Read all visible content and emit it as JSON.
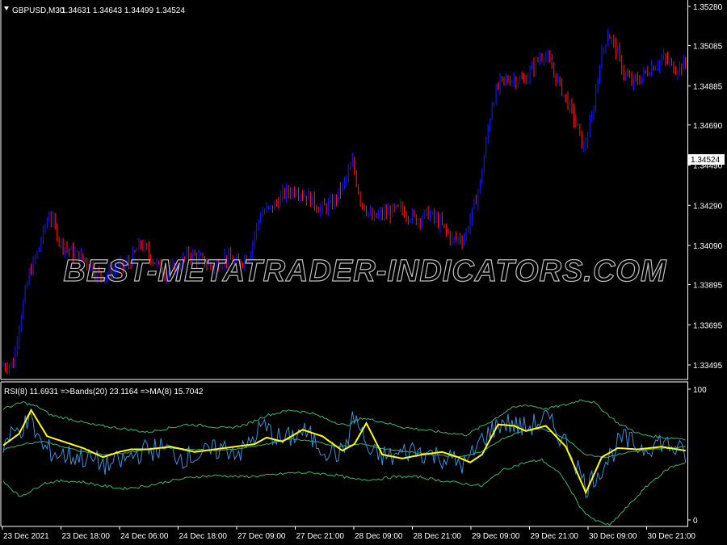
{
  "price_info": {
    "symbol": "GBPUSD,M30",
    "ohlc": "1.34631 1.34643 1.34499 1.34524"
  },
  "indicator_info": "RSI(8) 11.6931  =>Bands(20) 23.1164  =>MA(8) 15.7042",
  "current_price_tag": "1.34524",
  "watermark": "BEST-METATRADER-INDICATORS.COM",
  "price_axis_labels": [
    "1.35280",
    "1.35085",
    "1.34885",
    "1.34690",
    "1.34490",
    "1.34290",
    "1.34090",
    "1.33895",
    "1.33695",
    "1.33495"
  ],
  "indicator_axis_labels": [
    "100",
    "0"
  ],
  "time_labels": [
    "23 Dec 2021",
    "23 Dec 18:00",
    "24 Dec 06:00",
    "24 Dec 18:00",
    "27 Dec 09:00",
    "27 Dec 21:00",
    "28 Dec 09:00",
    "28 Dec 21:00",
    "29 Dec 09:00",
    "29 Dec 21:00",
    "30 Dec 09:00",
    "30 Dec 21:00"
  ],
  "colors": {
    "background": "#000000",
    "bull": "#1515ff",
    "bear": "#ff1010",
    "rsi": "#3a8fd8",
    "ma": "#ffff00",
    "bands": "#3cb371",
    "frame": "#ffffff"
  },
  "chart_data": [
    {
      "type": "line",
      "title": "GBPUSD,M30",
      "ylim": [
        1.334,
        1.3532
      ],
      "x": [
        "23 Dec 2021",
        "23 Dec 18:00",
        "24 Dec 06:00",
        "24 Dec 18:00",
        "27 Dec 09:00",
        "27 Dec 21:00",
        "28 Dec 09:00",
        "28 Dec 21:00",
        "29 Dec 09:00",
        "29 Dec 21:00",
        "30 Dec 09:00",
        "30 Dec 21:00"
      ],
      "series": [
        {
          "name": "GBPUSD,M30",
          "anchors": [
            [
              0,
              1.3349
            ],
            [
              6,
              1.335
            ],
            [
              9,
              1.337
            ],
            [
              14,
              1.3395
            ],
            [
              18,
              1.3405
            ],
            [
              24,
              1.3425
            ],
            [
              30,
              1.341
            ],
            [
              36,
              1.3405
            ],
            [
              42,
              1.3402
            ],
            [
              48,
              1.3395
            ],
            [
              52,
              1.3394
            ],
            [
              58,
              1.3398
            ],
            [
              64,
              1.34
            ],
            [
              70,
              1.341
            ],
            [
              76,
              1.3402
            ],
            [
              82,
              1.3395
            ],
            [
              88,
              1.3398
            ],
            [
              94,
              1.3405
            ],
            [
              100,
              1.3402
            ],
            [
              106,
              1.3398
            ],
            [
              112,
              1.3403
            ],
            [
              118,
              1.34
            ],
            [
              124,
              1.3404
            ],
            [
              130,
              1.3425
            ],
            [
              136,
              1.3428
            ],
            [
              142,
              1.3435
            ],
            [
              148,
              1.3437
            ],
            [
              154,
              1.3433
            ],
            [
              160,
              1.3427
            ],
            [
              166,
              1.343
            ],
            [
              172,
              1.344
            ],
            [
              176,
              1.345
            ],
            [
              180,
              1.3432
            ],
            [
              186,
              1.3422
            ],
            [
              192,
              1.3425
            ],
            [
              200,
              1.3427
            ],
            [
              208,
              1.3422
            ],
            [
              214,
              1.3425
            ],
            [
              220,
              1.342
            ],
            [
              226,
              1.3412
            ],
            [
              232,
              1.3413
            ],
            [
              236,
              1.3425
            ],
            [
              240,
              1.344
            ],
            [
              246,
              1.348
            ],
            [
              250,
              1.349
            ],
            [
              256,
              1.3492
            ],
            [
              262,
              1.3491
            ],
            [
              268,
              1.35
            ],
            [
              272,
              1.3505
            ],
            [
              278,
              1.3493
            ],
            [
              284,
              1.348
            ],
            [
              288,
              1.347
            ],
            [
              292,
              1.3457
            ],
            [
              296,
              1.3472
            ],
            [
              300,
              1.35
            ],
            [
              304,
              1.3515
            ],
            [
              308,
              1.3507
            ],
            [
              312,
              1.3495
            ],
            [
              316,
              1.349
            ],
            [
              320,
              1.3492
            ],
            [
              326,
              1.3498
            ],
            [
              332,
              1.3502
            ],
            [
              338,
              1.3497
            ],
            [
              342,
              1.3499
            ]
          ]
        }
      ]
    },
    {
      "type": "line",
      "title": "RSI(8) 11.6931  =>Bands(20) 23.1164  =>MA(8) 15.7042",
      "ylim": [
        0,
        100
      ],
      "series": [
        {
          "name": "RSI(8)",
          "last": 11.6931,
          "anchors": [
            [
              0,
              58
            ],
            [
              8,
              70
            ],
            [
              14,
              75
            ],
            [
              20,
              55
            ],
            [
              28,
              50
            ],
            [
              40,
              48
            ],
            [
              52,
              42
            ],
            [
              60,
              45
            ],
            [
              70,
              53
            ],
            [
              80,
              55
            ],
            [
              90,
              48
            ],
            [
              100,
              50
            ],
            [
              110,
              55
            ],
            [
              120,
              52
            ],
            [
              130,
              72
            ],
            [
              140,
              60
            ],
            [
              150,
              68
            ],
            [
              160,
              55
            ],
            [
              170,
              50
            ],
            [
              176,
              80
            ],
            [
              184,
              50
            ],
            [
              195,
              48
            ],
            [
              205,
              54
            ],
            [
              215,
              50
            ],
            [
              225,
              46
            ],
            [
              232,
              42
            ],
            [
              240,
              62
            ],
            [
              250,
              75
            ],
            [
              262,
              70
            ],
            [
              272,
              78
            ],
            [
              284,
              55
            ],
            [
              292,
              25
            ],
            [
              300,
              40
            ],
            [
              310,
              62
            ],
            [
              320,
              55
            ],
            [
              330,
              60
            ],
            [
              342,
              50
            ]
          ]
        },
        {
          "name": "MA(8)",
          "last": 15.7042,
          "anchors": [
            [
              0,
              57
            ],
            [
              8,
              66
            ],
            [
              14,
              84
            ],
            [
              22,
              64
            ],
            [
              30,
              60
            ],
            [
              40,
              55
            ],
            [
              50,
              48
            ],
            [
              58,
              52
            ],
            [
              64,
              54
            ],
            [
              72,
              54
            ],
            [
              84,
              56
            ],
            [
              96,
              52
            ],
            [
              106,
              54
            ],
            [
              116,
              56
            ],
            [
              126,
              58
            ],
            [
              132,
              63
            ],
            [
              140,
              60
            ],
            [
              150,
              69
            ],
            [
              160,
              64
            ],
            [
              170,
              53
            ],
            [
              176,
              58
            ],
            [
              182,
              74
            ],
            [
              190,
              50
            ],
            [
              200,
              47
            ],
            [
              210,
              50
            ],
            [
              220,
              52
            ],
            [
              228,
              48
            ],
            [
              234,
              44
            ],
            [
              240,
              50
            ],
            [
              248,
              73
            ],
            [
              256,
              72
            ],
            [
              262,
              68
            ],
            [
              272,
              72
            ],
            [
              282,
              56
            ],
            [
              292,
              21
            ],
            [
              300,
              48
            ],
            [
              308,
              55
            ],
            [
              318,
              54
            ],
            [
              330,
              56
            ],
            [
              342,
              53
            ]
          ]
        },
        {
          "name": "Bands(20)",
          "last": 23.1164,
          "upper": [
            [
              0,
              85
            ],
            [
              10,
              90
            ],
            [
              18,
              86
            ],
            [
              24,
              80
            ],
            [
              34,
              77
            ],
            [
              44,
              73
            ],
            [
              54,
              71
            ],
            [
              64,
              69
            ],
            [
              72,
              67
            ],
            [
              82,
              70
            ],
            [
              92,
              73
            ],
            [
              102,
              72
            ],
            [
              112,
              70
            ],
            [
              122,
              73
            ],
            [
              132,
              80
            ],
            [
              144,
              84
            ],
            [
              154,
              82
            ],
            [
              164,
              76
            ],
            [
              172,
              72
            ],
            [
              180,
              78
            ],
            [
              190,
              75
            ],
            [
              200,
              71
            ],
            [
              210,
              69
            ],
            [
              220,
              67
            ],
            [
              232,
              65
            ],
            [
              244,
              75
            ],
            [
              254,
              85
            ],
            [
              262,
              88
            ],
            [
              272,
              85
            ],
            [
              282,
              88
            ],
            [
              290,
              92
            ],
            [
              296,
              90
            ],
            [
              308,
              74
            ],
            [
              320,
              65
            ],
            [
              332,
              63
            ],
            [
              342,
              62
            ]
          ],
          "middle": [
            [
              0,
              54
            ],
            [
              10,
              58
            ],
            [
              20,
              60
            ],
            [
              30,
              56
            ],
            [
              40,
              52
            ],
            [
              50,
              50
            ],
            [
              60,
              51
            ],
            [
              72,
              54
            ],
            [
              84,
              55
            ],
            [
              96,
              54
            ],
            [
              108,
              53
            ],
            [
              120,
              55
            ],
            [
              132,
              58
            ],
            [
              144,
              62
            ],
            [
              156,
              60
            ],
            [
              168,
              56
            ],
            [
              180,
              58
            ],
            [
              192,
              54
            ],
            [
              204,
              52
            ],
            [
              216,
              50
            ],
            [
              228,
              48
            ],
            [
              240,
              52
            ],
            [
              250,
              62
            ],
            [
              260,
              68
            ],
            [
              270,
              70
            ],
            [
              282,
              62
            ],
            [
              292,
              50
            ],
            [
              302,
              48
            ],
            [
              314,
              52
            ],
            [
              326,
              54
            ],
            [
              342,
              56
            ]
          ],
          "lower": [
            [
              0,
              30
            ],
            [
              8,
              18
            ],
            [
              14,
              22
            ],
            [
              20,
              28
            ],
            [
              30,
              30
            ],
            [
              40,
              29
            ],
            [
              50,
              26
            ],
            [
              60,
              24
            ],
            [
              72,
              26
            ],
            [
              84,
              30
            ],
            [
              96,
              33
            ],
            [
              108,
              34
            ],
            [
              120,
              33
            ],
            [
              132,
              34
            ],
            [
              144,
              36
            ],
            [
              156,
              36
            ],
            [
              168,
              34
            ],
            [
              176,
              31
            ],
            [
              186,
              31
            ],
            [
              196,
              33
            ],
            [
              208,
              33
            ],
            [
              220,
              30
            ],
            [
              230,
              28
            ],
            [
              240,
              26
            ],
            [
              250,
              38
            ],
            [
              262,
              44
            ],
            [
              270,
              46
            ],
            [
              280,
              34
            ],
            [
              290,
              8
            ],
            [
              296,
              0
            ],
            [
              304,
              -4
            ],
            [
              314,
              12
            ],
            [
              324,
              28
            ],
            [
              334,
              40
            ],
            [
              342,
              44
            ]
          ]
        }
      ]
    }
  ]
}
